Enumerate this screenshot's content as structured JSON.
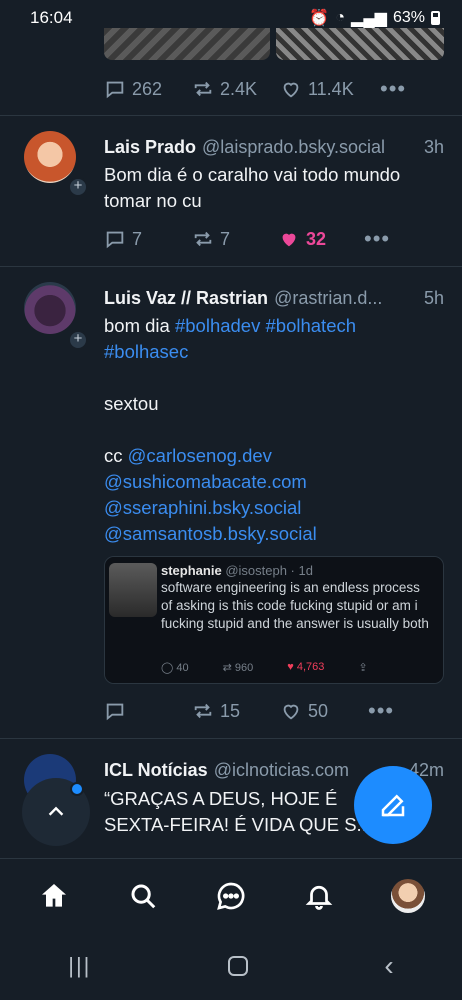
{
  "status": {
    "time": "16:04",
    "battery": "63%"
  },
  "prev_post": {
    "replies": "262",
    "reposts": "2.4K",
    "likes": "11.4K"
  },
  "post1": {
    "name": "Lais Prado",
    "handle": "@laisprado.bsky.social",
    "time": "3h",
    "text": "Bom dia é o caralho vai todo mundo tomar no cu",
    "replies": "7",
    "reposts": "7",
    "likes": "32"
  },
  "post2": {
    "name": "Luis Vaz // Rastrian",
    "handle": "@rastrian.d...",
    "time": "5h",
    "line1_prefix": "bom dia ",
    "tag1": "#bolhadev",
    "tag2": "#bolhatech",
    "tag3": "#bolhasec",
    "line2": "sextou",
    "cc_prefix": "cc ",
    "mention1": "@carlosenog.dev",
    "mention2": "@sushicomabacate.com",
    "mention3": "@sseraphini.bsky.social",
    "mention4": "@samsantosb.bsky.social",
    "quote": {
      "name": "stephanie",
      "handle": "@isosteph · 1d",
      "text": "software engineering is an endless process of asking is this code fucking stupid or am i fucking stupid and the answer is usually both",
      "replies": "40",
      "retweets": "960",
      "likes": "4,763"
    },
    "replies": "",
    "reposts": "15",
    "likes": "50"
  },
  "post3": {
    "name": "ICL Notícias",
    "handle": "@iclnoticias.com",
    "time": "42m",
    "text": "“GRAÇAS A DEUS, HOJE É SEXTA-FEIRA! É VIDA QUE S..."
  },
  "colors": {
    "background": "#161e27",
    "accent": "#1d8cff",
    "like": "#ec4899",
    "link": "#3b8df0"
  },
  "icons": [
    "reply-icon",
    "repost-icon",
    "heart-icon",
    "more-icon",
    "home-icon",
    "search-icon",
    "chat-icon",
    "bell-icon",
    "compose-icon",
    "chevron-up-icon"
  ]
}
